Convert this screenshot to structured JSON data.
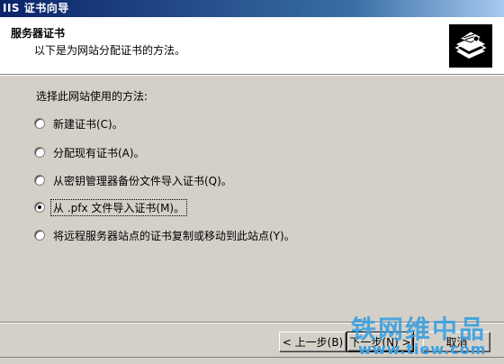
{
  "window": {
    "title": "IIS 证书向导"
  },
  "header": {
    "title": "服务器证书",
    "subtitle": "以下是为网站分配证书的方法。",
    "icon": "certificate-icon"
  },
  "main": {
    "prompt": "选择此网站使用的方法:",
    "options": [
      {
        "label": "新建证书(C)。",
        "selected": false
      },
      {
        "label": "分配现有证书(A)。",
        "selected": false
      },
      {
        "label": "从密钥管理器备份文件导入证书(Q)。",
        "selected": false
      },
      {
        "label": "从 .pfx 文件导入证书(M)。",
        "selected": true
      },
      {
        "label": "将远程服务器站点的证书复制或移动到此站点(Y)。",
        "selected": false
      }
    ]
  },
  "buttons": {
    "back": "< 上一步(B)",
    "next": "下一步(N) >",
    "cancel": "取消"
  },
  "watermark": {
    "text": "铁网维中品",
    "url": "www.tiew.com"
  }
}
